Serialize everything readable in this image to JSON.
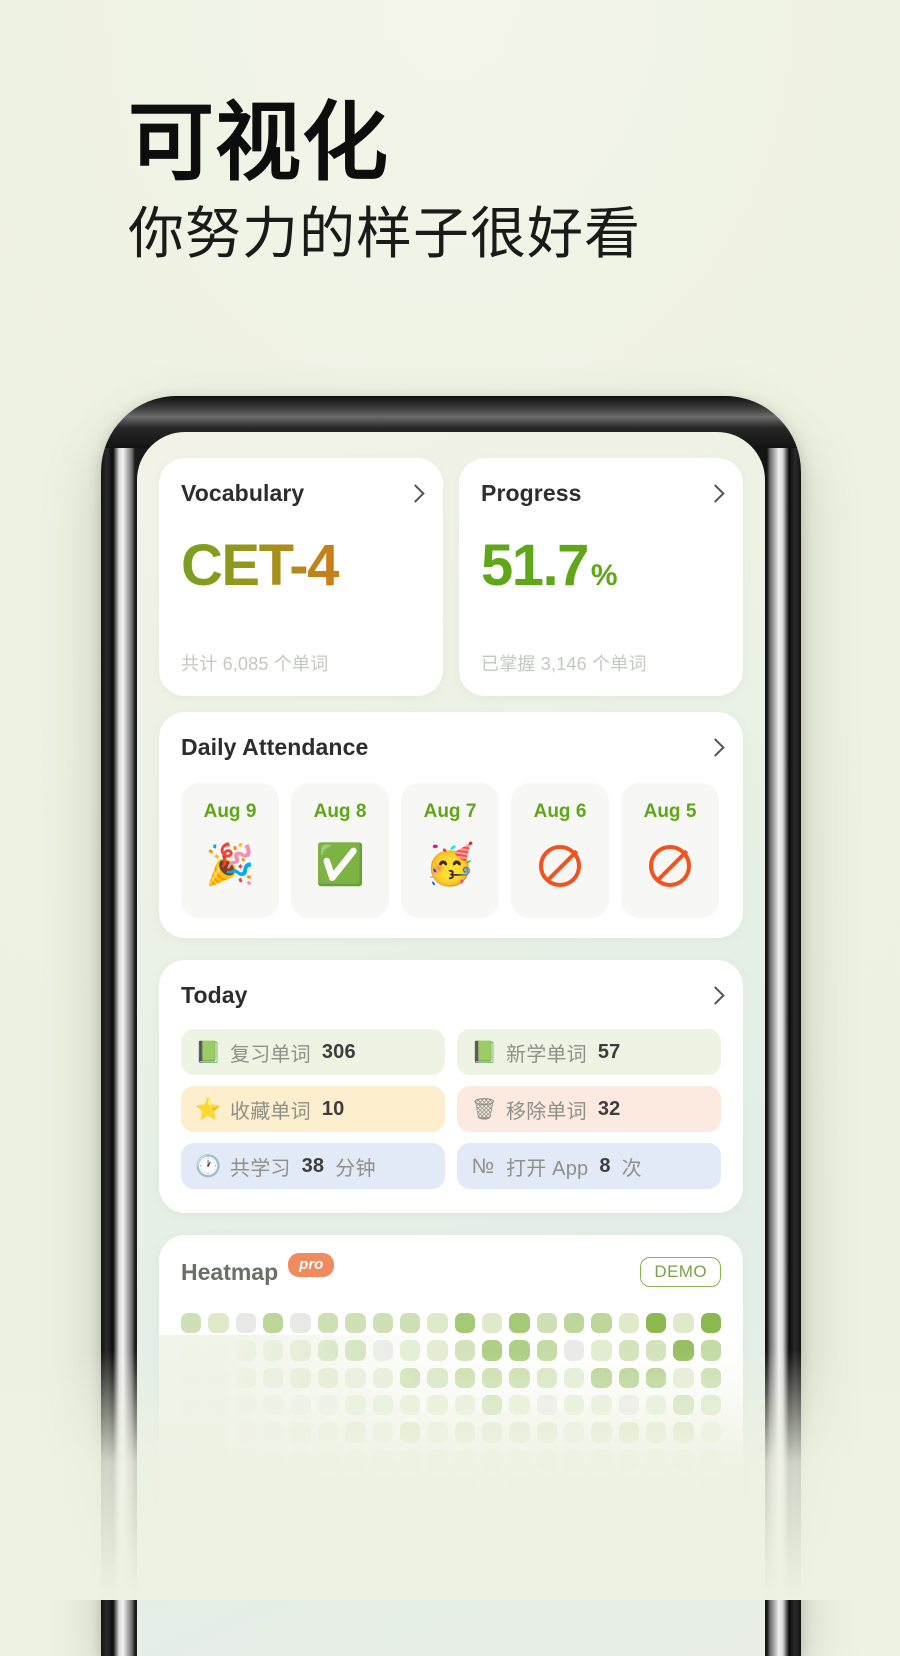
{
  "promo": {
    "title": "可视化",
    "subtitle": "你努力的样子很好看"
  },
  "colors": {
    "page_bg": "#eef2e2",
    "screen_bg": "#e9efe6",
    "brand_green": "#5fa618",
    "accent_orange": "#f0531e",
    "pro_badge": "#f08a5f",
    "demo_border": "#8bb24e"
  },
  "app": {
    "vocabulary_card": {
      "title": "Vocabulary",
      "value": "CET-4",
      "caption": "共计 6,085 个单词",
      "chevron": "chevron-right-icon"
    },
    "progress_card": {
      "title": "Progress",
      "value": "51.7",
      "unit": "%",
      "caption": "已掌握 3,146 个单词",
      "chevron": "chevron-right-icon"
    },
    "attendance_card": {
      "title": "Daily Attendance",
      "chevron": "chevron-right-icon",
      "days": [
        {
          "label": "Aug 9",
          "icon": "party-popper-icon",
          "emoji": "🎉"
        },
        {
          "label": "Aug 8",
          "icon": "verified-check-icon",
          "emoji": "✅"
        },
        {
          "label": "Aug 7",
          "icon": "partying-face-icon",
          "emoji": "🥳"
        },
        {
          "label": "Aug 6",
          "icon": "prohibited-icon",
          "emoji": ""
        },
        {
          "label": "Aug 5",
          "icon": "prohibited-icon",
          "emoji": ""
        }
      ]
    },
    "today_card": {
      "title": "Today",
      "chevron": "chevron-right-icon",
      "chips": [
        {
          "icon": "green-book-icon",
          "glyph": "📗",
          "label": "复习单词",
          "value": "306",
          "tone": "green"
        },
        {
          "icon": "green-book-icon",
          "glyph": "📗",
          "label": "新学单词",
          "value": "57",
          "tone": "green"
        },
        {
          "icon": "star-icon",
          "glyph": "⭐",
          "label": "收藏单词",
          "value": "10",
          "tone": "amber"
        },
        {
          "icon": "trash-icon",
          "glyph": "🗑",
          "label": "移除单词",
          "value": "32",
          "tone": "red"
        },
        {
          "icon": "clock-icon",
          "glyph": "🕐",
          "label": "共学习",
          "value": "38",
          "suffix": "分钟",
          "tone": "blue"
        },
        {
          "icon": "numero-icon",
          "glyph": "№",
          "label": "打开 App",
          "value": "8",
          "suffix": "次",
          "tone": "blue"
        }
      ]
    },
    "heatmap_card": {
      "title": "Heatmap",
      "pro_badge": "pro",
      "demo_badge": "DEMO",
      "columns": 20,
      "rows": 9,
      "levels": [
        [
          2,
          1,
          0,
          3,
          0,
          2,
          2,
          2,
          2,
          1,
          4,
          1,
          4,
          2,
          3,
          3,
          1,
          5,
          1,
          5
        ],
        [
          1,
          1,
          2,
          2,
          2,
          3,
          3,
          0,
          1,
          1,
          2,
          4,
          4,
          3,
          0,
          1,
          2,
          2,
          5,
          3
        ],
        [
          2,
          2,
          2,
          2,
          2,
          2,
          1,
          1,
          3,
          2,
          3,
          3,
          3,
          2,
          1,
          4,
          4,
          4,
          1,
          3
        ],
        [
          0,
          0,
          0,
          0,
          0,
          0,
          1,
          1,
          1,
          1,
          1,
          3,
          1,
          0,
          1,
          1,
          0,
          1,
          3,
          2
        ],
        [
          0,
          0,
          0,
          0,
          1,
          1,
          2,
          1,
          3,
          1,
          2,
          2,
          2,
          2,
          1,
          2,
          3,
          2,
          3,
          1
        ],
        [
          0,
          0,
          0,
          0,
          0,
          1,
          1,
          1,
          1,
          2,
          1,
          1,
          1,
          1,
          1,
          2,
          2,
          2,
          2,
          2
        ],
        [
          0,
          0,
          0,
          0,
          0,
          0,
          0,
          1,
          1,
          1,
          0,
          1,
          1,
          1,
          1,
          2,
          2,
          2,
          1,
          2
        ],
        [
          0,
          0,
          0,
          0,
          0,
          0,
          0,
          0,
          1,
          1,
          1,
          1,
          1,
          1,
          1,
          1,
          2,
          2,
          2,
          2
        ],
        [
          0,
          0,
          0,
          0,
          0,
          0,
          0,
          0,
          0,
          1,
          1,
          1,
          1,
          1,
          1,
          1,
          1,
          2,
          2,
          2
        ]
      ],
      "palette": [
        "#e8e8e6",
        "#dfeacb",
        "#cfe0b4",
        "#bdd79a",
        "#a4c977",
        "#8cb94f"
      ]
    }
  }
}
